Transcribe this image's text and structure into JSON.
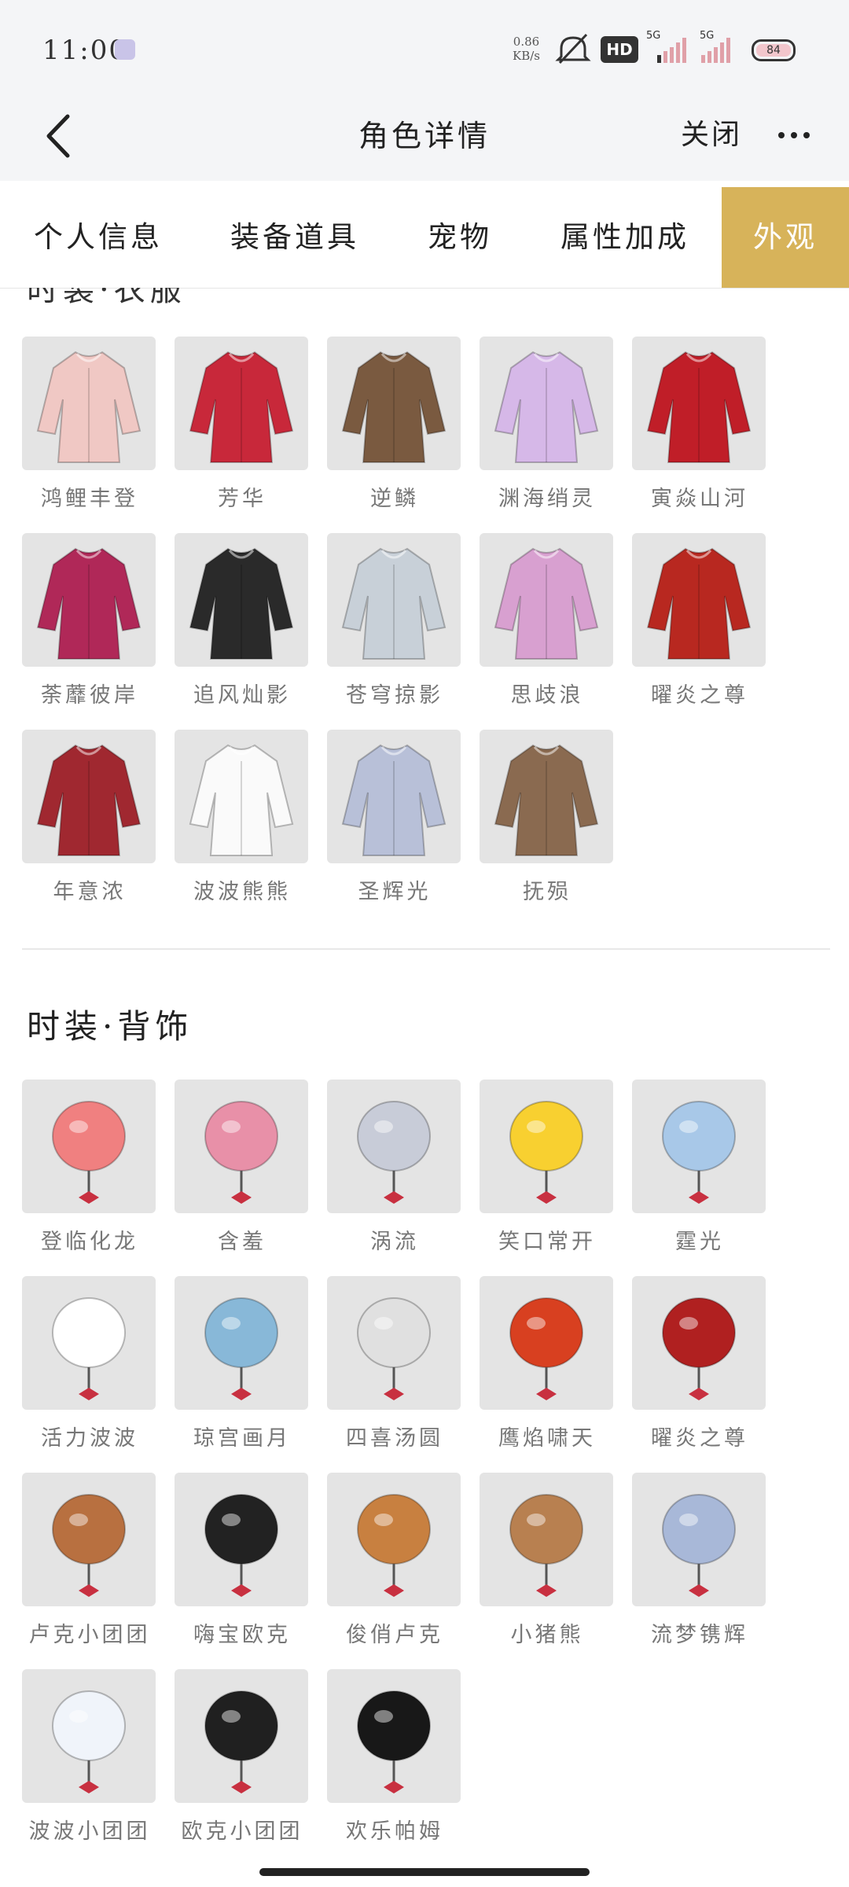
{
  "status_bar": {
    "time": "11:00",
    "net_speed_top": "0.86",
    "net_speed_bottom": "KB/s",
    "hd_label": "HD",
    "sim1_label": "5G",
    "sim2_label": "5G",
    "battery_text": "84"
  },
  "nav": {
    "title": "角色详情",
    "close_label": "关闭"
  },
  "tabs": [
    {
      "label": "个人信息",
      "active": false
    },
    {
      "label": "装备道具",
      "active": false
    },
    {
      "label": "宠物",
      "active": false
    },
    {
      "label": "属性加成",
      "active": false
    },
    {
      "label": "外观",
      "active": true
    }
  ],
  "sections": [
    {
      "title": "时装·衣服",
      "items": [
        {
          "name": "鸿鲤丰登",
          "color": "#f0c8c4"
        },
        {
          "name": "芳华",
          "color": "#c8283a"
        },
        {
          "name": "逆鳞",
          "color": "#7a5a40"
        },
        {
          "name": "渊海绡灵",
          "color": "#d6b8e8"
        },
        {
          "name": "寅焱山河",
          "color": "#c01e28"
        },
        {
          "name": "荼蘼彼岸",
          "color": "#b02858"
        },
        {
          "name": "追风灿影",
          "color": "#2a2a2a"
        },
        {
          "name": "苍穹掠影",
          "color": "#c8d0d8"
        },
        {
          "name": "思歧浪",
          "color": "#d8a0d0"
        },
        {
          "name": "曜炎之尊",
          "color": "#b82820"
        },
        {
          "name": "年意浓",
          "color": "#a02830"
        },
        {
          "name": "波波熊熊",
          "color": "#fafafa"
        },
        {
          "name": "圣辉光",
          "color": "#b8c0d8"
        },
        {
          "name": "抚殒",
          "color": "#8a6a50"
        }
      ]
    },
    {
      "title": "时装·背饰",
      "items": [
        {
          "name": "登临化龙",
          "color": "#f08080"
        },
        {
          "name": "含羞",
          "color": "#e890a8"
        },
        {
          "name": "涡流",
          "color": "#c8ccd8"
        },
        {
          "name": "笑口常开",
          "color": "#f8d030"
        },
        {
          "name": "霆光",
          "color": "#a8c8e8"
        },
        {
          "name": "活力波波",
          "color": "#ffffff"
        },
        {
          "name": "琼宫画月",
          "color": "#88b8d8"
        },
        {
          "name": "四喜汤圆",
          "color": "#e0e0e0"
        },
        {
          "name": "鹰焰啸天",
          "color": "#d84020"
        },
        {
          "name": "曜炎之尊",
          "color": "#b02020"
        },
        {
          "name": "卢克小团团",
          "color": "#b87040"
        },
        {
          "name": "嗨宝欧克",
          "color": "#222222"
        },
        {
          "name": "俊俏卢克",
          "color": "#c88040"
        },
        {
          "name": "小猪熊",
          "color": "#b88050"
        },
        {
          "name": "流梦镌辉",
          "color": "#a8b8d8"
        },
        {
          "name": "波波小团团",
          "color": "#f0f4fa"
        },
        {
          "name": "欧克小团团",
          "color": "#202020"
        },
        {
          "name": "欢乐帕姆",
          "color": "#181818"
        }
      ]
    }
  ]
}
